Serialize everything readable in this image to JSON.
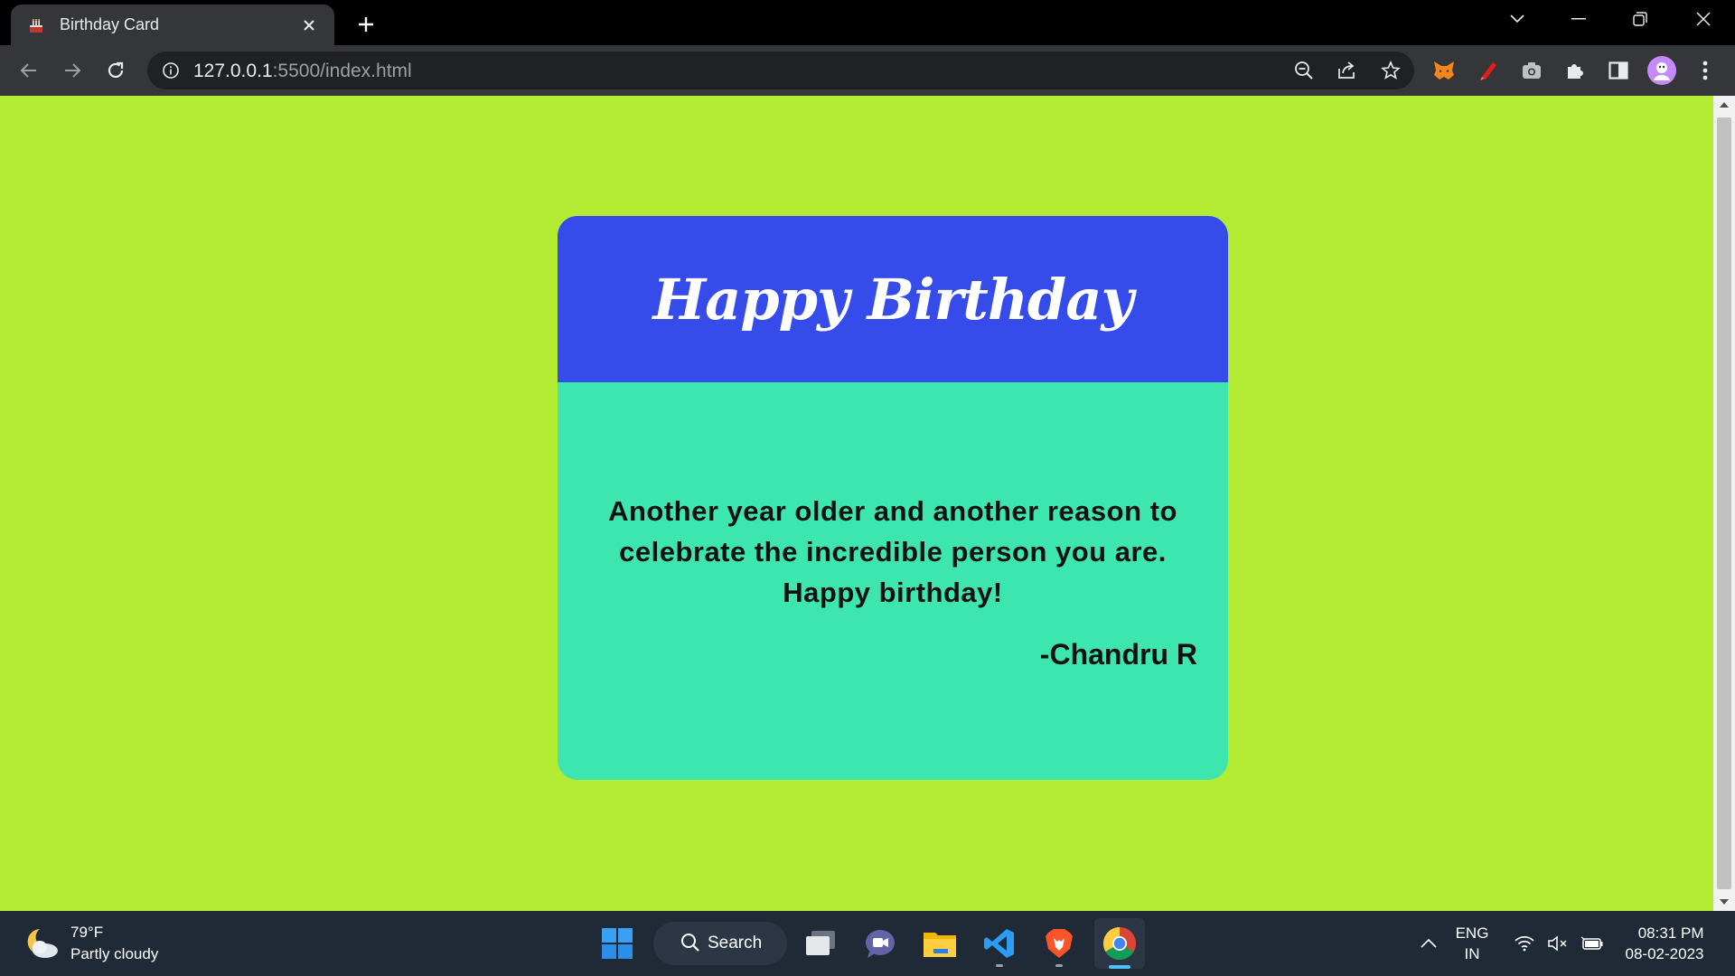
{
  "browser": {
    "tab": {
      "title": "Birthday Card",
      "favicon": "birthday-cake-icon"
    },
    "url_host": "127.0.0.1",
    "url_rest": ":5500/index.html"
  },
  "card": {
    "title": "Happy Birthday",
    "message_line1": "Another year older and another reason to",
    "message_line2": "celebrate the incredible person you are.",
    "message_line3": "Happy birthday!",
    "signature": "-Chandru R",
    "colors": {
      "page_bg": "#b3ec33",
      "header_bg": "#354cea",
      "body_bg": "#3de6ae"
    }
  },
  "taskbar": {
    "weather_temp": "79°F",
    "weather_desc": "Partly cloudy",
    "search_label": "Search",
    "lang_line1": "ENG",
    "lang_line2": "IN",
    "time": "08:31 PM",
    "date": "08-02-2023"
  }
}
